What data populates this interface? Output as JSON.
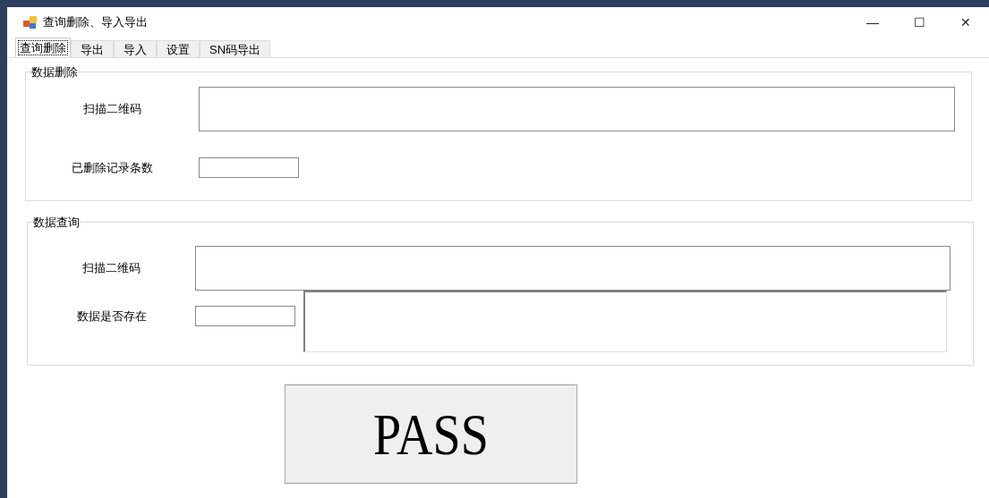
{
  "window": {
    "title": "查询删除、导入导出",
    "controls": [
      "—",
      "☐",
      "✕"
    ]
  },
  "tabs": [
    {
      "label": "查询删除",
      "selected": true
    },
    {
      "label": "导出",
      "selected": false
    },
    {
      "label": "导入",
      "selected": false
    },
    {
      "label": "设置",
      "selected": false
    },
    {
      "label": "SN码导出",
      "selected": false
    }
  ],
  "groups": [
    {
      "title": "数据删除",
      "rows": [
        {
          "label": "扫描二维码",
          "fields": [
            {
              "kind": "wide"
            }
          ]
        },
        {
          "label": "已删除记录条数",
          "fields": [
            {
              "kind": "small"
            }
          ]
        }
      ]
    },
    {
      "title": "数据查询",
      "rows": [
        {
          "label": "扫描二维码",
          "fields": [
            {
              "kind": "wide"
            }
          ]
        },
        {
          "label": "数据是否存在",
          "fields": [
            {
              "kind": "small"
            },
            {
              "kind": "multiline"
            }
          ]
        }
      ]
    }
  ],
  "result_button": {
    "label": "PASS"
  }
}
